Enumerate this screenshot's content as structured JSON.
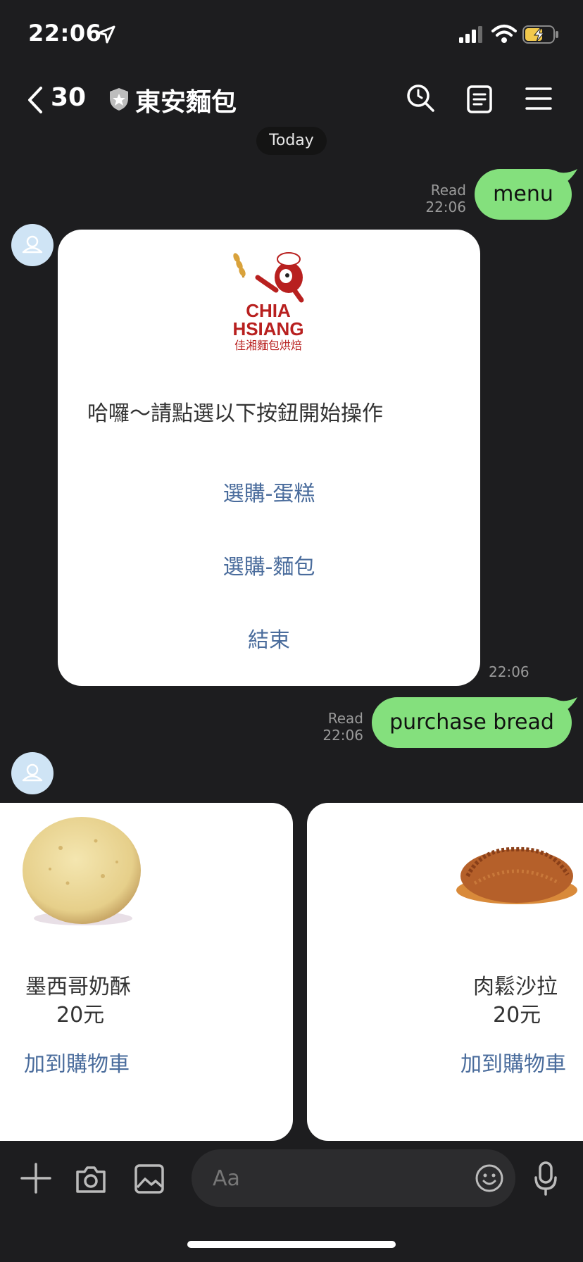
{
  "status_bar": {
    "time": "22:06"
  },
  "header": {
    "back_count": "30",
    "title": "東安麵包"
  },
  "date_separator": "Today",
  "messages": {
    "out1": {
      "text": "menu",
      "read_label": "Read",
      "time": "22:06"
    },
    "menu_card": {
      "logo_text_line1": "CHIA",
      "logo_text_line2": "HSIANG",
      "logo_text_line3": "佳湘麵包烘焙",
      "prompt": "哈囉～請點選以下按鈕開始操作",
      "buttons": [
        "選購-蛋糕",
        "選購-麵包",
        "結束"
      ],
      "time": "22:06"
    },
    "out2": {
      "text": "purchase bread",
      "read_label": "Read",
      "time": "22:06"
    }
  },
  "products": [
    {
      "name": "墨西哥奶酥",
      "price": "20元",
      "action": "加到購物車"
    },
    {
      "name": "肉鬆沙拉",
      "price": "20元",
      "action": "加到購物車"
    }
  ],
  "composer": {
    "placeholder": "Aa"
  },
  "colors": {
    "background": "#1d1d1f",
    "sent_bubble": "#84e07d",
    "link": "#4a6c9c",
    "card": "#ffffff"
  }
}
